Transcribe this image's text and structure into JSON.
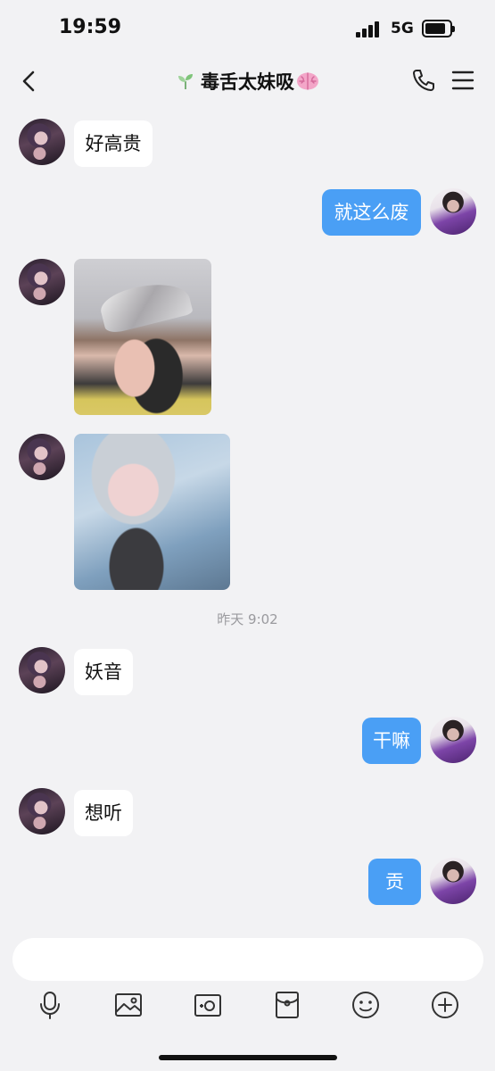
{
  "status_bar": {
    "time": "19:59",
    "network": "5G"
  },
  "header": {
    "title": "毒舌太妹吸"
  },
  "messages": {
    "m1": "好高贵",
    "m2": "就这么废",
    "timestamp": "昨天 9:02",
    "m5": "妖音",
    "m6": "干嘛",
    "m7": "想听",
    "m8": "贡"
  },
  "input": {
    "placeholder": ""
  },
  "icons": {
    "back": "chevron-left-icon",
    "title_prefix": "sprout-icon",
    "title_suffix": "brain-icon",
    "call": "phone-icon",
    "menu": "menu-icon",
    "toolbar": [
      "microphone-icon",
      "image-icon",
      "camera-icon",
      "red-packet-icon",
      "emoji-icon",
      "plus-icon"
    ]
  },
  "colors": {
    "background": "#f2f2f4",
    "outgoing_bubble": "#4a9ff5",
    "incoming_bubble": "#ffffff",
    "timestamp_text": "#9a9a9e"
  }
}
